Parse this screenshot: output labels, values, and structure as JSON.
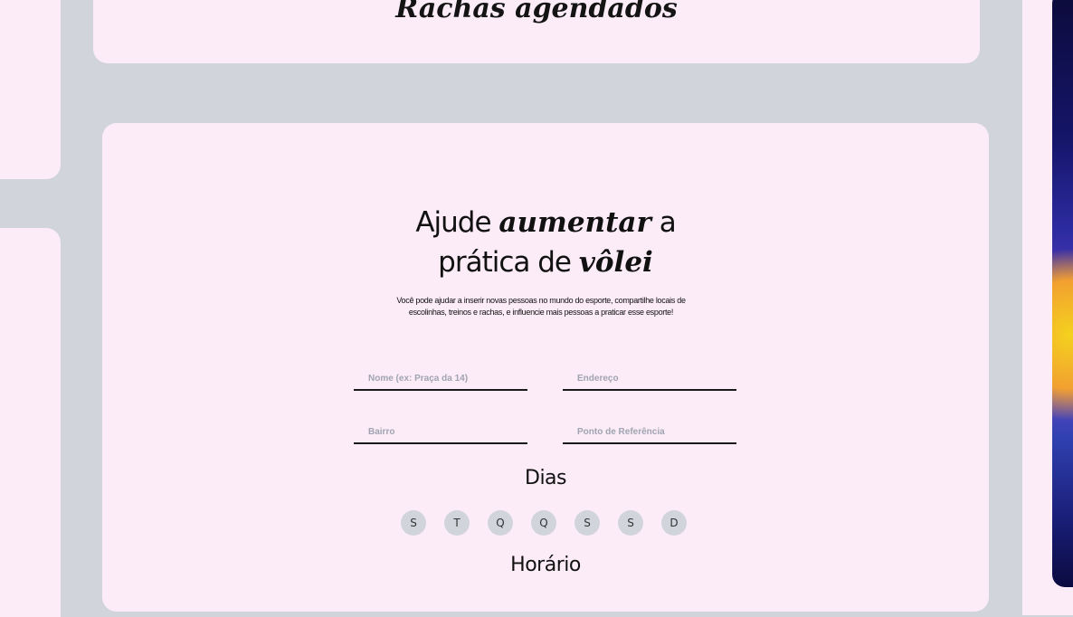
{
  "header": {
    "title": "Rachas agendados"
  },
  "form": {
    "headline": {
      "part1": "Ajude",
      "emphasis1": "aumentar",
      "part2": "a",
      "part3": "prática de",
      "emphasis2": "vôlei"
    },
    "intro_text": "Você pode ajudar a inserir novas pessoas no mundo do esporte, compartilhe locais de escolinhas, treinos e rachas, e influencie mais pessoas a praticar esse esporte!",
    "fields": {
      "nome": {
        "placeholder": "Nome (ex: Praça da 14)",
        "value": ""
      },
      "endereco": {
        "placeholder": "Endereço",
        "value": ""
      },
      "bairro": {
        "placeholder": "Bairro",
        "value": ""
      },
      "referencia": {
        "placeholder": "Ponto de Referência",
        "value": ""
      }
    },
    "days_title": "Dias",
    "days": [
      "S",
      "T",
      "Q",
      "Q",
      "S",
      "S",
      "D"
    ],
    "time_title": "Horário"
  },
  "colors": {
    "background": "#d1d5db",
    "card": "#fcecf8",
    "day_chip": "#d1d5db",
    "text": "#111111"
  }
}
